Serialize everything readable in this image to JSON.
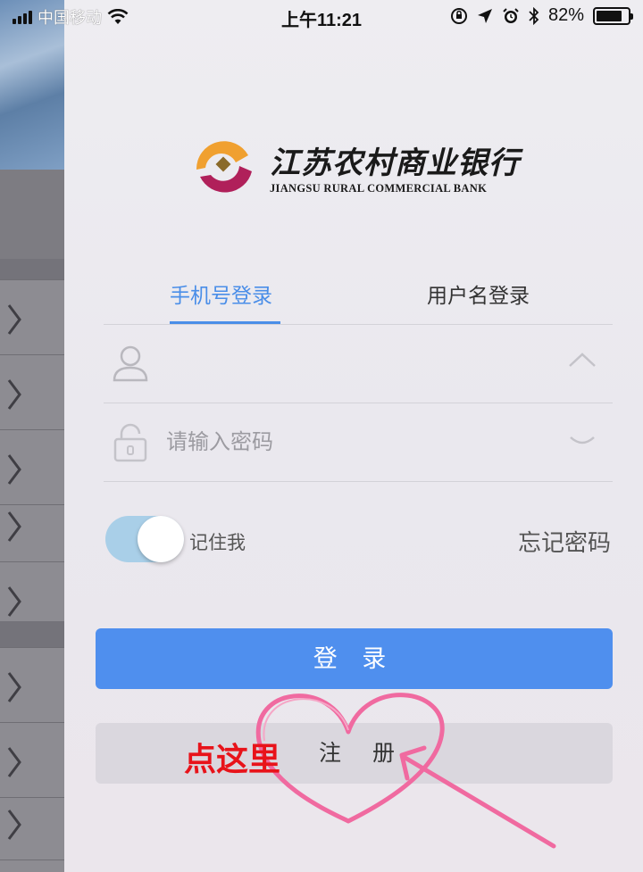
{
  "status_bar": {
    "carrier": "中国移动",
    "time": "上午11:21",
    "battery": "82%",
    "battery_level": 0.82,
    "icons": [
      "signal-icon",
      "wifi-icon",
      "orientation-lock-icon",
      "location-icon",
      "alarm-icon",
      "bluetooth-icon",
      "battery-icon"
    ]
  },
  "logo": {
    "name_cn": "江苏农村商业银行",
    "name_en": "JIANGSU RURAL COMMERCIAL BANK",
    "colors": {
      "orange": "#f0a030",
      "crimson": "#b0205a",
      "diamond": "#8a6a2a"
    }
  },
  "tabs": [
    {
      "label": "手机号登录",
      "active": true
    },
    {
      "label": "用户名登录",
      "active": false
    }
  ],
  "form": {
    "username": {
      "value": "",
      "placeholder": "",
      "icon": "user-icon",
      "trailing_icon": "chevron-up-icon"
    },
    "password": {
      "value": "",
      "placeholder": "请输入密码",
      "icon": "lock-icon",
      "trailing_icon": "eye-closed-icon"
    },
    "remember": {
      "label": "记住我",
      "checked": true
    },
    "forgot_label": "忘记密码"
  },
  "buttons": {
    "login": "登 录",
    "register": "注 册"
  },
  "annotation": {
    "text": "点这里",
    "color": "#e8131a",
    "shape": "heart-with-arrow",
    "shape_color": "#f06aa0"
  },
  "colors": {
    "accent": "#4f8fee",
    "toggle_on": "#a9cfe8"
  }
}
